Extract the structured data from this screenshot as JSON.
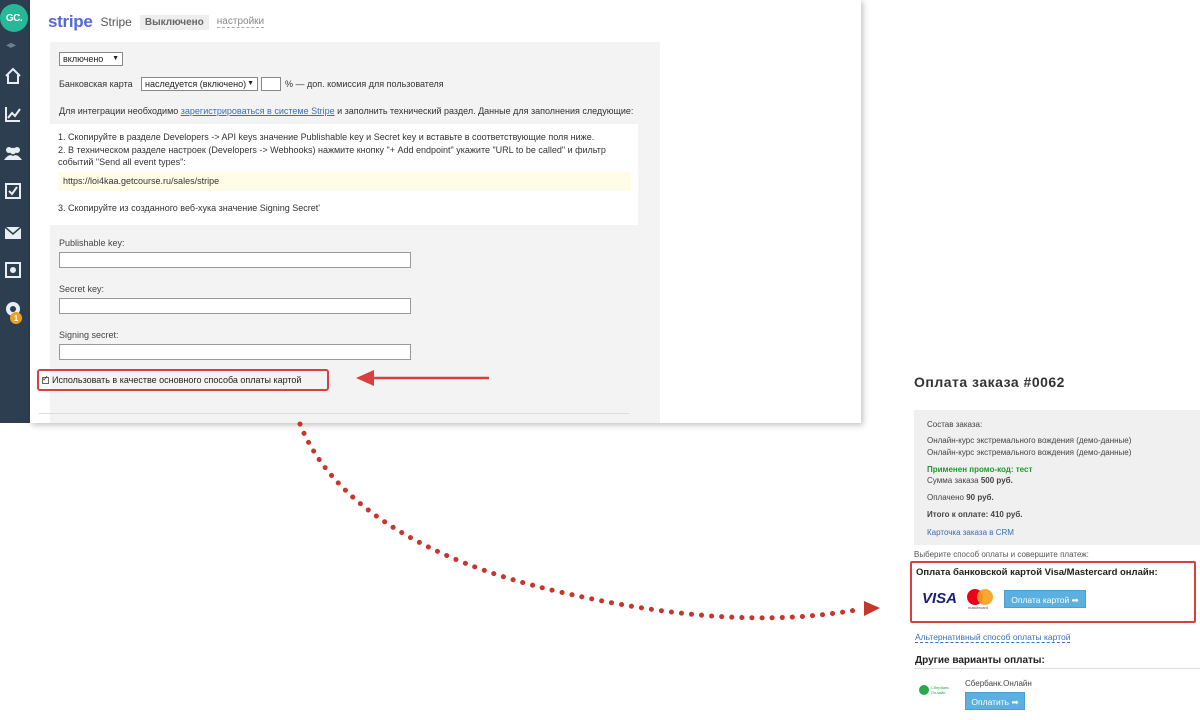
{
  "sidebar": {
    "logo_text": "GC.",
    "collapse_glyph": "◂▸",
    "icons": [
      "home-icon",
      "chart-icon",
      "users-icon",
      "tasks-icon",
      "mail-icon",
      "safe-icon",
      "chat-icon"
    ],
    "notification_count": "1",
    "bg_color": "#2d3e50"
  },
  "stripe": {
    "logo": "stripe",
    "name": "Stripe",
    "status_badge": "Выключено",
    "settings_link": "настройки",
    "enabled_select": "включено",
    "card_label": "Банковская карта",
    "card_select": "наследуется (включено)",
    "commission_text": "% — доп. комиссия для пользователя",
    "intro_text_before": "Для интеграции необходимо ",
    "intro_link": "зарегистрироваться в системе Stripe",
    "intro_text_after": " и заполнить технический раздел. Данные для заполнения следующие:",
    "step1": "1. Скопируйте в разделе Developers -> API keys значение Publishable key и Secret key и вставьте в соответствующие поля ниже.",
    "step2a": "2. В техническом разделе настроек (Developers -> Webhooks) нажмите кнопку \"+ Add endpoint\" укажите \"URL to be called\" и фильтр",
    "step2b": "событий \"Send all event types\":",
    "webhook_url": "https://loi4kaa.getcourse.ru/sales/stripe",
    "step3": "3. Скопируйте из созданного веб-хука значение Signing Secret'",
    "publishable_label": "Publishable key:",
    "secret_label": "Secret key:",
    "signing_label": "Signing secret:",
    "primary_checkbox_label": "Использовать в качестве основного способа оплаты картой",
    "accent_color": "#5469d4",
    "highlight_color": "#d84040"
  },
  "checkout": {
    "title": "Оплата заказа #0062",
    "composition_label": "Состав заказа:",
    "item1": "Онлайн-курс экстремального вождения (демо-данные)",
    "item2": "Онлайн-курс экстремального вождения (демо-данные)",
    "promo": "Применен промо-код: тест",
    "sum_label": "Сумма заказа ",
    "sum_value": "500 руб.",
    "paid_label": "Оплачено ",
    "paid_value": "90 руб.",
    "total": "Итого к оплате: 410 руб.",
    "crm_link": "Карточка заказа в CRM",
    "hint": "Выберите способ оплаты и совершите платеж:",
    "card_title": "Оплата банковской картой Visa/Mastercard онлайн:",
    "visa": "VISA",
    "mastercard": "mastercard",
    "pay_card_button": "Оплата картой ➡",
    "alt_link": "Альтернативный способ оплаты картой",
    "other_title": "Другие варианты оплаты:",
    "sber_logo": "Сбербанк Онлайн",
    "sber_name": "Сбербанк.Онлайн",
    "pay_button": "Оплатить ➡",
    "button_color": "#5bb0e0"
  }
}
